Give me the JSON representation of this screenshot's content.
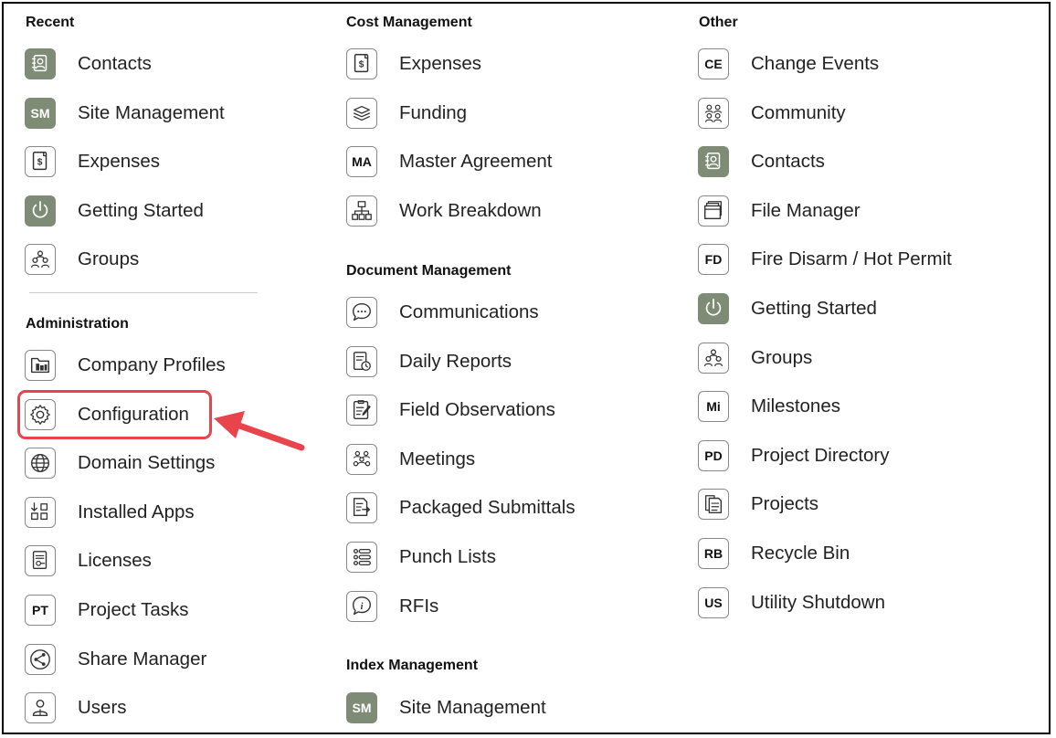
{
  "colors": {
    "accent": "#e8444c",
    "icon_fill": "#7e8c76",
    "icon_border": "#888888"
  },
  "columns": [
    {
      "groups": [
        {
          "heading": "Recent",
          "items": [
            {
              "label": "Contacts",
              "icon": "contacts-icon",
              "filled": true
            },
            {
              "label": "Site Management",
              "icon": "SM",
              "filled": true,
              "text_icon": true
            },
            {
              "label": "Expenses",
              "icon": "expenses-icon"
            },
            {
              "label": "Getting Started",
              "icon": "power-icon",
              "filled": true
            },
            {
              "label": "Groups",
              "icon": "groups-icon"
            }
          ]
        },
        {
          "heading": "Administration",
          "items": [
            {
              "label": "Company Profiles",
              "icon": "building-icon"
            },
            {
              "label": "Configuration",
              "icon": "gear-icon",
              "highlighted": true
            },
            {
              "label": "Domain Settings",
              "icon": "globe-icon"
            },
            {
              "label": "Installed Apps",
              "icon": "apps-icon"
            },
            {
              "label": "Licenses",
              "icon": "license-icon"
            },
            {
              "label": "Project Tasks",
              "icon": "PT",
              "text_icon": true
            },
            {
              "label": "Share Manager",
              "icon": "share-icon"
            },
            {
              "label": "Users",
              "icon": "user-icon"
            }
          ]
        }
      ]
    },
    {
      "groups": [
        {
          "heading": "Cost Management",
          "items": [
            {
              "label": "Expenses",
              "icon": "expenses-icon"
            },
            {
              "label": "Funding",
              "icon": "funding-icon"
            },
            {
              "label": "Master Agreement",
              "icon": "MA",
              "text_icon": true
            },
            {
              "label": "Work Breakdown",
              "icon": "hierarchy-icon"
            }
          ]
        },
        {
          "heading": "Document Management",
          "items": [
            {
              "label": "Communications",
              "icon": "chat-icon"
            },
            {
              "label": "Daily Reports",
              "icon": "daily-report-icon"
            },
            {
              "label": "Field Observations",
              "icon": "clipboard-icon"
            },
            {
              "label": "Meetings",
              "icon": "meeting-icon"
            },
            {
              "label": "Packaged Submittals",
              "icon": "submittal-icon"
            },
            {
              "label": "Punch Lists",
              "icon": "list-icon"
            },
            {
              "label": "RFIs",
              "icon": "info-icon"
            }
          ]
        },
        {
          "heading": "Index Management",
          "items": [
            {
              "label": "Site Management",
              "icon": "SM",
              "filled": true,
              "text_icon": true
            }
          ]
        }
      ]
    },
    {
      "groups": [
        {
          "heading": "Other",
          "items": [
            {
              "label": "Change Events",
              "icon": "CE",
              "text_icon": true
            },
            {
              "label": "Community",
              "icon": "community-icon"
            },
            {
              "label": "Contacts",
              "icon": "contacts-icon",
              "filled": true
            },
            {
              "label": "File Manager",
              "icon": "folder-icon"
            },
            {
              "label": "Fire Disarm / Hot Permit",
              "icon": "FD",
              "text_icon": true
            },
            {
              "label": "Getting Started",
              "icon": "power-icon",
              "filled": true
            },
            {
              "label": "Groups",
              "icon": "groups-icon"
            },
            {
              "label": "Milestones",
              "icon": "Mi",
              "text_icon": true
            },
            {
              "label": "Project Directory",
              "icon": "PD",
              "text_icon": true
            },
            {
              "label": "Projects",
              "icon": "projects-icon"
            },
            {
              "label": "Recycle Bin",
              "icon": "RB",
              "text_icon": true
            },
            {
              "label": "Utility Shutdown",
              "icon": "US",
              "text_icon": true
            }
          ]
        }
      ]
    }
  ]
}
